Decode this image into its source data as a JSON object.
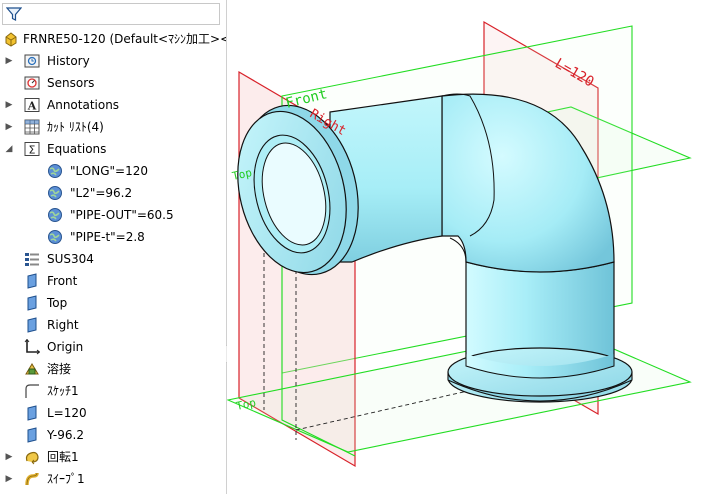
{
  "tree": {
    "root_label": "FRNRE50-120  (Default<ﾏｼﾝ加工><<D",
    "items": [
      {
        "label": "History"
      },
      {
        "label": "Sensors"
      },
      {
        "label": "Annotations"
      },
      {
        "label": "ｶｯﾄ ﾘｽﾄ(4)"
      },
      {
        "label": "Equations"
      },
      {
        "label": "\"LONG\"=120"
      },
      {
        "label": "\"L2\"=96.2"
      },
      {
        "label": "\"PIPE-OUT\"=60.5"
      },
      {
        "label": "\"PIPE-t\"=2.8"
      },
      {
        "label": "SUS304"
      },
      {
        "label": "Front"
      },
      {
        "label": "Top"
      },
      {
        "label": "Right"
      },
      {
        "label": "Origin"
      },
      {
        "label": "溶接"
      },
      {
        "label": "ｽｹｯﾁ1"
      },
      {
        "label": "L=120"
      },
      {
        "label": "Y-96.2"
      },
      {
        "label": "回転1"
      },
      {
        "label": "ｽｲｰﾌﾟ1"
      }
    ]
  },
  "viewport": {
    "plane_labels": {
      "front": "Front",
      "right": "Right",
      "l120": "L=120",
      "top": "Top"
    }
  },
  "colors": {
    "plane_red": "#d8222a",
    "plane_green": "#22dd22",
    "part_fill": "#a6ecf6"
  }
}
